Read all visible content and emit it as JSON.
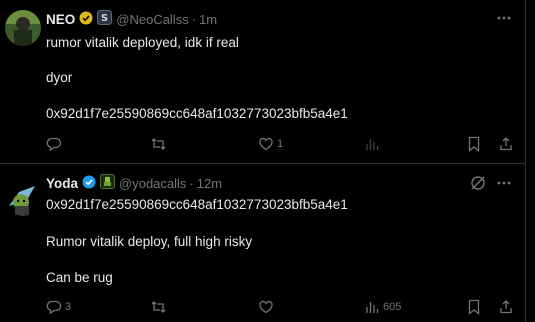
{
  "tweets": [
    {
      "name": "NEO",
      "handle": "@NeoCallss",
      "dot": "·",
      "time": "1m",
      "lines": [
        "rumor vitalik deployed, idk if real",
        "dyor",
        "0x92d1f7e25590869cc648af1032773023bfb5a4e1"
      ],
      "actions": {
        "replies": "",
        "reposts": "",
        "likes": "1",
        "views": ""
      }
    },
    {
      "name": "Yoda",
      "handle": "@yodacalls",
      "dot": "·",
      "time": "12m",
      "lines": [
        "0x92d1f7e25590869cc648af1032773023bfb5a4e1",
        "Rumor vitalik deploy, full high risky",
        "Can be rug"
      ],
      "actions": {
        "replies": "3",
        "reposts": "",
        "likes": "",
        "views": "605"
      }
    }
  ],
  "colors": {
    "background": "#000000",
    "text": "#e7e9ea",
    "muted": "#71767b",
    "border": "#2f3336",
    "verified_gold": "#e2b719",
    "verified_blue": "#1d9bf0"
  }
}
